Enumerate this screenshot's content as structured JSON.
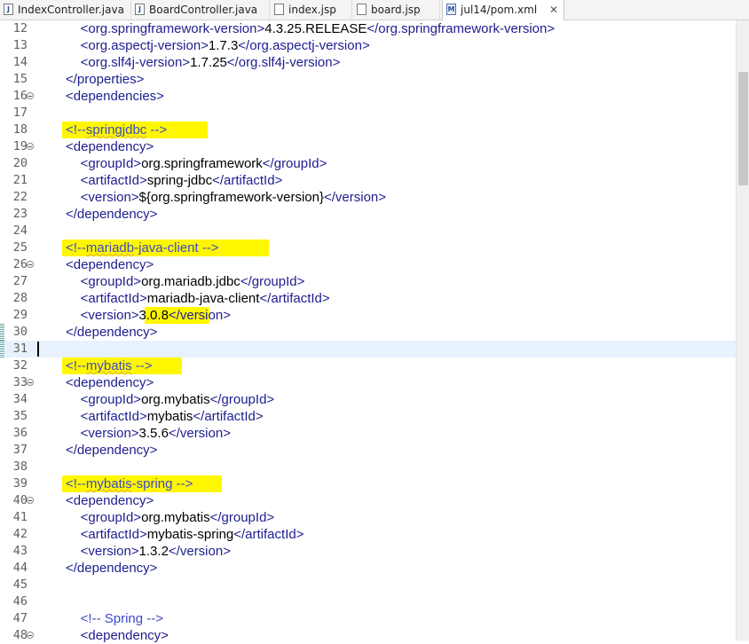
{
  "tabs": [
    {
      "label": "IndexController.java",
      "icon": "java-file-icon",
      "active": false
    },
    {
      "label": "BoardController.java",
      "icon": "java-file-icon",
      "active": false
    },
    {
      "label": "index.jsp",
      "icon": "jsp-file-icon",
      "active": false
    },
    {
      "label": "board.jsp",
      "icon": "jsp-file-icon",
      "active": false
    },
    {
      "label": "jul14/pom.xml",
      "icon": "maven-pom-icon",
      "active": true,
      "close": "✕"
    }
  ],
  "editor": {
    "current_line": 31,
    "highlight_color": "#fff700",
    "lines": [
      {
        "n": "12",
        "parts": [
          [
            "    ",
            "txt"
          ],
          [
            "<org.springframework-version>",
            "tag"
          ],
          [
            "4.3.25.RELEASE",
            "txt"
          ],
          [
            "</org.springframework-version>",
            "tag"
          ]
        ]
      },
      {
        "n": "13",
        "parts": [
          [
            "    ",
            "txt"
          ],
          [
            "<org.aspectj-version>",
            "tag"
          ],
          [
            "1.7.3",
            "txt"
          ],
          [
            "</org.aspectj-version>",
            "tag"
          ]
        ]
      },
      {
        "n": "14",
        "parts": [
          [
            "    ",
            "txt"
          ],
          [
            "<org.slf4j-version>",
            "tag"
          ],
          [
            "1.7.25",
            "txt"
          ],
          [
            "</org.slf4j-version>",
            "tag"
          ]
        ]
      },
      {
        "n": "15",
        "parts": [
          [
            "</properties>",
            "tag"
          ]
        ]
      },
      {
        "n": "16",
        "fold": true,
        "parts": [
          [
            "<dependencies>",
            "tag"
          ]
        ]
      },
      {
        "n": "17",
        "parts": []
      },
      {
        "n": "18",
        "parts": [
          [
            "<!--",
            "cmt"
          ],
          [
            "springjdbc",
            "cmt squig"
          ],
          [
            " -->",
            "cmt"
          ]
        ]
      },
      {
        "n": "19",
        "fold": true,
        "parts": [
          [
            "<dependency>",
            "tag"
          ]
        ]
      },
      {
        "n": "20",
        "parts": [
          [
            "    ",
            "txt"
          ],
          [
            "<groupId>",
            "tag"
          ],
          [
            "org.springframework",
            "txt"
          ],
          [
            "</groupId>",
            "tag"
          ]
        ]
      },
      {
        "n": "21",
        "parts": [
          [
            "    ",
            "txt"
          ],
          [
            "<artifactId>",
            "tag"
          ],
          [
            "spring-jdbc",
            "txt"
          ],
          [
            "</artifactId>",
            "tag"
          ]
        ]
      },
      {
        "n": "22",
        "parts": [
          [
            "    ",
            "txt"
          ],
          [
            "<version>",
            "tag"
          ],
          [
            "${org.springframework-version}",
            "txt"
          ],
          [
            "</version>",
            "tag"
          ]
        ]
      },
      {
        "n": "23",
        "parts": [
          [
            "</dependency>",
            "tag"
          ]
        ]
      },
      {
        "n": "24",
        "parts": []
      },
      {
        "n": "25",
        "parts": [
          [
            "<!--",
            "cmt"
          ],
          [
            "mariadb",
            "cmt squig"
          ],
          [
            "-java-client -->",
            "cmt"
          ]
        ]
      },
      {
        "n": "26",
        "fold": true,
        "parts": [
          [
            "<dependency>",
            "tag"
          ]
        ]
      },
      {
        "n": "27",
        "parts": [
          [
            "    ",
            "txt"
          ],
          [
            "<groupId>",
            "tag"
          ],
          [
            "org.mariadb.jdbc",
            "txt"
          ],
          [
            "</groupId>",
            "tag"
          ]
        ]
      },
      {
        "n": "28",
        "parts": [
          [
            "    ",
            "txt"
          ],
          [
            "<artifactId>",
            "tag"
          ],
          [
            "mariadb-java-client",
            "txt"
          ],
          [
            "</artifactId>",
            "tag"
          ]
        ]
      },
      {
        "n": "29",
        "parts": [
          [
            "    ",
            "txt"
          ],
          [
            "<version>",
            "tag"
          ],
          [
            "3.0.8",
            "txt"
          ],
          [
            "</version>",
            "tag"
          ]
        ]
      },
      {
        "n": "30",
        "parts": [
          [
            "</dependency>",
            "tag"
          ]
        ]
      },
      {
        "n": "31",
        "parts": []
      },
      {
        "n": "32",
        "parts": [
          [
            "<!--",
            "cmt"
          ],
          [
            "mybatis",
            "cmt squig"
          ],
          [
            " -->",
            "cmt"
          ]
        ]
      },
      {
        "n": "33",
        "fold": true,
        "parts": [
          [
            "<dependency>",
            "tag"
          ]
        ]
      },
      {
        "n": "34",
        "parts": [
          [
            "    ",
            "txt"
          ],
          [
            "<groupId>",
            "tag"
          ],
          [
            "org.mybatis",
            "txt"
          ],
          [
            "</groupId>",
            "tag"
          ]
        ]
      },
      {
        "n": "35",
        "parts": [
          [
            "    ",
            "txt"
          ],
          [
            "<artifactId>",
            "tag"
          ],
          [
            "mybatis",
            "txt"
          ],
          [
            "</artifactId>",
            "tag"
          ]
        ]
      },
      {
        "n": "36",
        "parts": [
          [
            "    ",
            "txt"
          ],
          [
            "<version>",
            "tag"
          ],
          [
            "3.5.6",
            "txt"
          ],
          [
            "</version>",
            "tag"
          ]
        ]
      },
      {
        "n": "37",
        "parts": [
          [
            "</dependency>",
            "tag"
          ]
        ]
      },
      {
        "n": "38",
        "parts": []
      },
      {
        "n": "39",
        "parts": [
          [
            "<!--",
            "cmt"
          ],
          [
            "mybatis",
            "cmt squig"
          ],
          [
            "-spring -->",
            "cmt"
          ]
        ]
      },
      {
        "n": "40",
        "fold": true,
        "parts": [
          [
            "<dependency>",
            "tag"
          ]
        ]
      },
      {
        "n": "41",
        "parts": [
          [
            "    ",
            "txt"
          ],
          [
            "<groupId>",
            "tag"
          ],
          [
            "org.mybatis",
            "txt"
          ],
          [
            "</groupId>",
            "tag"
          ]
        ]
      },
      {
        "n": "42",
        "parts": [
          [
            "    ",
            "txt"
          ],
          [
            "<artifactId>",
            "tag"
          ],
          [
            "mybatis-spring",
            "txt"
          ],
          [
            "</artifactId>",
            "tag"
          ]
        ]
      },
      {
        "n": "43",
        "parts": [
          [
            "    ",
            "txt"
          ],
          [
            "<version>",
            "tag"
          ],
          [
            "1.3.2",
            "txt"
          ],
          [
            "</version>",
            "tag"
          ]
        ]
      },
      {
        "n": "44",
        "parts": [
          [
            "</dependency>",
            "tag"
          ]
        ]
      },
      {
        "n": "45",
        "parts": []
      },
      {
        "n": "46",
        "parts": []
      },
      {
        "n": "47",
        "parts": [
          [
            "    ",
            "txt"
          ],
          [
            "<!-- Spring -->",
            "cmt"
          ]
        ]
      },
      {
        "n": "48",
        "fold": true,
        "parts": [
          [
            "    ",
            "txt"
          ],
          [
            "<dependency>",
            "tag"
          ]
        ]
      }
    ]
  }
}
